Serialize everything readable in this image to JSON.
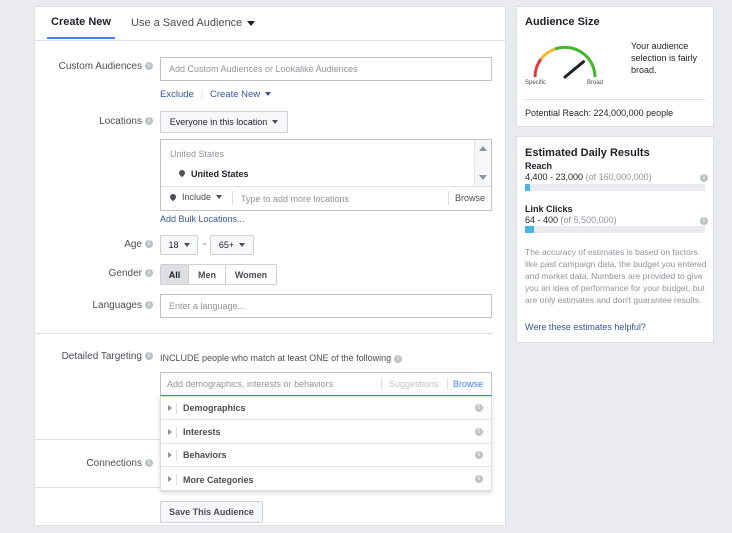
{
  "tabs": [
    {
      "label": "Create New"
    },
    {
      "label": "Use a Saved Audience"
    }
  ],
  "custom_audiences": {
    "label": "Custom Audiences",
    "placeholder": "Add Custom Audiences or Lookalike Audiences",
    "exclude": "Exclude",
    "create_new": "Create New"
  },
  "locations": {
    "label": "Locations",
    "dropdown": "Everyone in this location",
    "country_header": "United States",
    "selected": "United States",
    "include": "Include",
    "placeholder": "Type to add more locations",
    "browse": "Browse",
    "bulk": "Add Bulk Locations..."
  },
  "age": {
    "label": "Age",
    "min": "18",
    "dash": "-",
    "max": "65+"
  },
  "gender": {
    "label": "Gender",
    "options": [
      "All",
      "Men",
      "Women"
    ]
  },
  "languages": {
    "label": "Languages",
    "placeholder": "Enter a language..."
  },
  "detailed_targeting": {
    "label": "Detailed Targeting",
    "include_text": "INCLUDE people who match at least ONE of the following",
    "placeholder": "Add demographics, interests or behaviors",
    "suggestions": "Suggestions",
    "browse": "Browse",
    "categories": [
      "Demographics",
      "Interests",
      "Behaviors",
      "More Categories"
    ]
  },
  "connections": {
    "label": "Connections"
  },
  "save_button": "Save This Audience",
  "audience_size": {
    "title": "Audience Size",
    "specific": "Specific",
    "broad": "Broad",
    "description": "Your audience selection is fairly broad.",
    "reach": "Potential Reach: 224,000,000 people",
    "gauge_level": 0.78
  },
  "daily_results": {
    "title": "Estimated Daily Results",
    "reach_label": "Reach",
    "reach_value": "4,400 - 23,000",
    "reach_of": "(of 160,000,000)",
    "reach_fill": 0.03,
    "clicks_label": "Link Clicks",
    "clicks_value": "64 - 400",
    "clicks_of": "(of 5,500,000)",
    "clicks_fill": 0.05,
    "disclaimer": "The accuracy of estimates is based on factors like past campaign data, the budget you entered and market data. Numbers are provided to give you an idea of performance for your budget, but are only estimates and don't guarantee results.",
    "helpful": "Were these estimates helpful?"
  },
  "colors": {
    "accent": "#4080ff",
    "link": "#365899",
    "bar": "#4cb4e4"
  }
}
